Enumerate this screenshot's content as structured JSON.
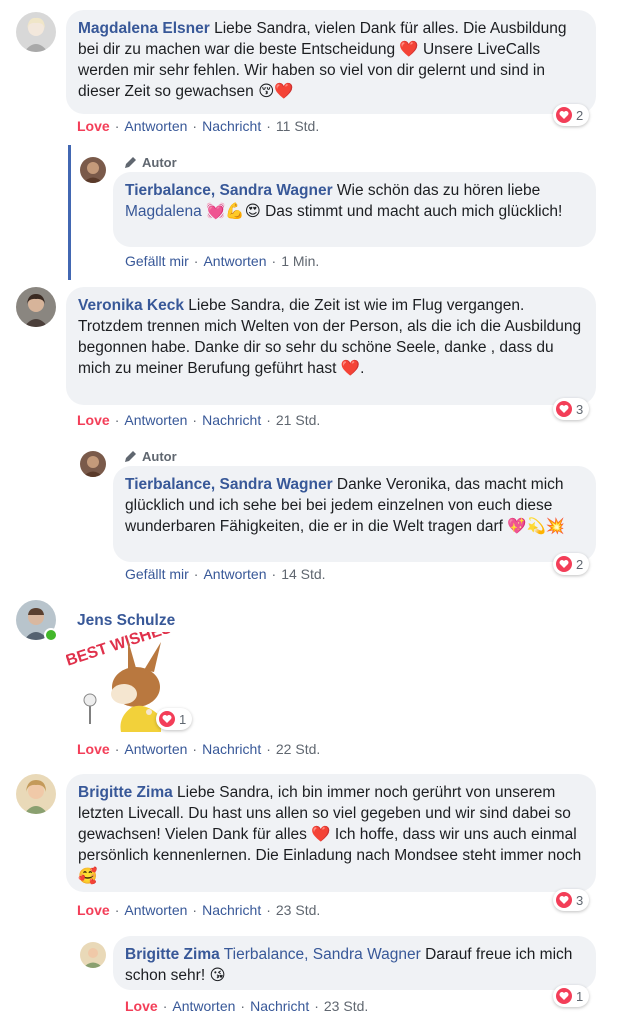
{
  "comments": [
    {
      "author": "Magdalena Elsner",
      "text": "Liebe Sandra, vielen Dank für alles. Die Ausbildung bei dir zu machen war die beste Entscheidung ❤️ Unsere LiveCalls werden mir sehr fehlen. Wir haben so viel von dir gelernt und sind in dieser Zeit so gewachsen 😚❤️",
      "reaction_label": "Love",
      "reply_label": "Antworten",
      "message_label": "Nachricht",
      "time": "11 Std.",
      "reaction_count": "2"
    },
    {
      "badge": "Autor",
      "author": "Tierbalance, Sandra Wagner",
      "text_before": "Wie schön das zu hören liebe",
      "mention": "Magdalena",
      "text_after": "💓💪😍 Das stimmt und macht auch mich glücklich!",
      "like_label": "Gefällt mir",
      "reply_label": "Antworten",
      "time": "1 Min."
    },
    {
      "author": "Veronika Keck",
      "text": "Liebe Sandra, die Zeit ist wie im Flug vergangen. Trotzdem trennen mich Welten von der Person, als die ich die Ausbildung begonnen habe. Danke dir so sehr du schöne Seele, danke , dass du mich zu meiner Berufung geführt hast ❤️.",
      "reaction_label": "Love",
      "reply_label": "Antworten",
      "message_label": "Nachricht",
      "time": "21 Std.",
      "reaction_count": "3"
    },
    {
      "badge": "Autor",
      "author": "Tierbalance, Sandra Wagner",
      "text": "Danke Veronika, das macht mich glücklich und ich sehe bei bei jedem einzelnen von euch diese wunderbaren Fähigkeiten, die er in die Welt tragen darf 💖💫💥",
      "like_label": "Gefällt mir",
      "reply_label": "Antworten",
      "time": "14 Std.",
      "reaction_count": "2"
    },
    {
      "author": "Jens Schulze",
      "sticker_text": "BEST WISHES",
      "reaction_label": "Love",
      "reply_label": "Antworten",
      "message_label": "Nachricht",
      "time": "22 Std.",
      "reaction_count": "1"
    },
    {
      "author": "Brigitte Zima",
      "text": "Liebe Sandra, ich bin immer noch gerührt von unserem letzten Livecall. Du hast uns allen so viel gegeben und wir sind dabei so gewachsen! Vielen Dank für alles ❤️ Ich hoffe, dass wir uns auch einmal persönlich kennenlernen. Die Einladung nach Mondsee steht immer noch 🥰",
      "reaction_label": "Love",
      "reply_label": "Antworten",
      "message_label": "Nachricht",
      "time": "23 Std.",
      "reaction_count": "3"
    },
    {
      "author": "Brigitte Zima",
      "mention": "Tierbalance, Sandra Wagner",
      "text": "Darauf freue ich mich schon sehr! 😘",
      "reaction_label": "Love",
      "reply_label": "Antworten",
      "message_label": "Nachricht",
      "time": "23 Std.",
      "reaction_count": "1"
    }
  ],
  "colors": {
    "link": "#385898",
    "love": "#f33e58",
    "bubble": "#f0f2f5",
    "thread": "#4267b2",
    "online": "#42b72a"
  }
}
